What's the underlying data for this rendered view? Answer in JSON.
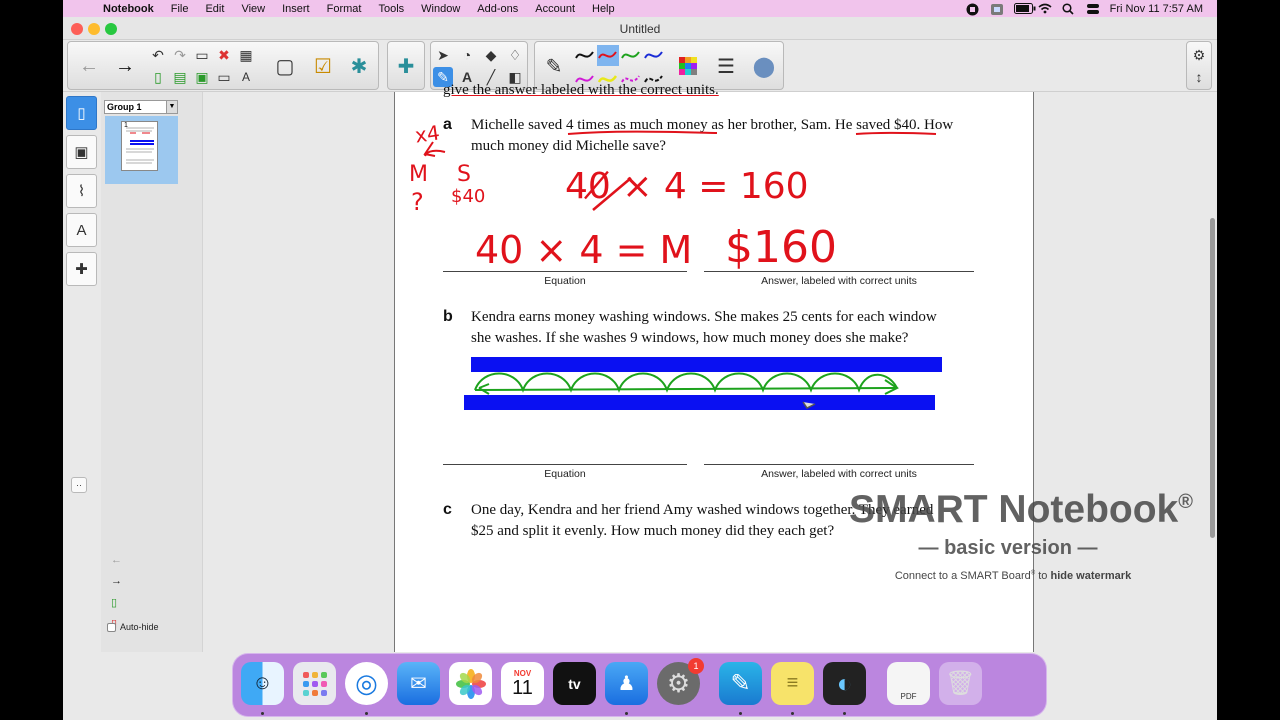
{
  "menubar": {
    "apple": "",
    "items": [
      "Notebook",
      "File",
      "Edit",
      "View",
      "Insert",
      "Format",
      "Tools",
      "Window",
      "Add-ons",
      "Account",
      "Help"
    ],
    "clock": "Fri Nov 11  7:57 AM"
  },
  "window": {
    "title": "Untitled"
  },
  "sorter": {
    "group_label": "Group 1",
    "page_number": "1",
    "autohide_label": "Auto-hide"
  },
  "page": {
    "partial_top": "give the answer labeled with the correct units.",
    "q_a": {
      "letter": "a",
      "line1": "Michelle saved 4 times as much money as her brother, Sam. He saved $40. How",
      "line2": "much money did Michelle save?"
    },
    "q_b": {
      "letter": "b",
      "line1": "Kendra earns money washing windows. She makes 25 cents for each window",
      "line2": "she washes. If she washes 9 windows, how much money does she make?"
    },
    "q_c": {
      "letter": "c",
      "line1": "One day, Kendra and her friend Amy washed windows together. They earned",
      "line2": "$25 and split it evenly. How much money did they each get?"
    },
    "caption_equation": "Equation",
    "caption_answer": "Answer, labeled with correct units"
  },
  "handwriting": {
    "x4": "x4",
    "M": "M",
    "S": "S",
    "q": "?",
    "s40": "$40",
    "calc": "40̸ × 4 = 160",
    "equation": "40 × 4 = M",
    "answer": "$160"
  },
  "watermark": {
    "title": "SMART Notebook",
    "reg": "®",
    "subtitle": "— basic version —",
    "connect_pre": "Connect to a SMART Board",
    "connect_tm": "®",
    "connect_mid": " to ",
    "connect_bold": "hide watermark"
  },
  "dock": {
    "calendar_month": "NOV",
    "calendar_day": "11",
    "appletv_label": "tv",
    "settings_badge": "1",
    "pdf_label": "PDF"
  },
  "colors": {
    "ink_red": "#e0121b",
    "ink_green": "#1da21d",
    "highlight_blue": "#0a10f2",
    "menubar": "#f1c4ec",
    "dock": "#b67bde"
  }
}
